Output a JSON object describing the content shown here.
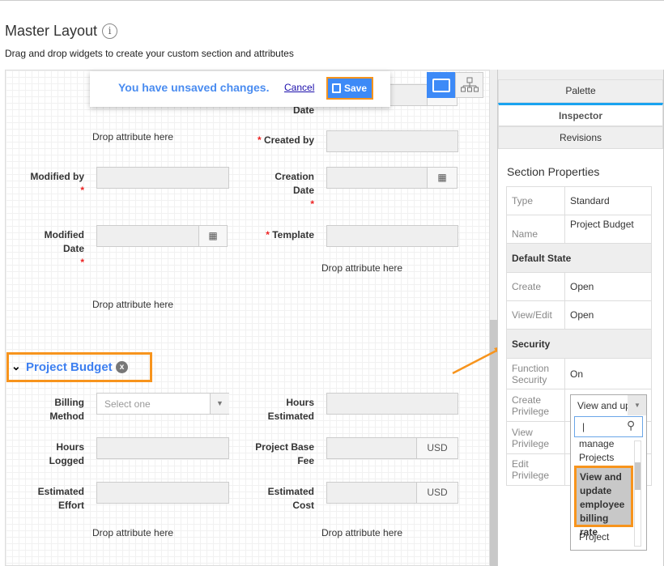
{
  "header": {
    "title": "Master Layout",
    "info_icon": "i",
    "subtitle": "Drag and drop widgets to create your custom section and attributes"
  },
  "toast": {
    "message": "You have unsaved changes.",
    "cancel": "Cancel",
    "save": "Save"
  },
  "form": {
    "date_label": "Date",
    "drop": "Drop attribute here",
    "created_by": "Created by",
    "modified_by": "Modified by",
    "creation_date": [
      "Creation",
      "Date"
    ],
    "modified_date": [
      "Modified",
      "Date"
    ],
    "template": "Template",
    "required_mark": "*",
    "section_title": "Project Budget",
    "billing_method": [
      "Billing",
      "Method"
    ],
    "billing_placeholder": "Select one",
    "hours_estimated": [
      "Hours",
      "Estimated"
    ],
    "hours_logged": [
      "Hours",
      "Logged"
    ],
    "project_base_fee": [
      "Project Base",
      "Fee"
    ],
    "estimated_effort": [
      "Estimated",
      "Effort"
    ],
    "estimated_cost": [
      "Estimated",
      "Cost"
    ],
    "currency": "USD"
  },
  "panel": {
    "tabs": [
      "Palette",
      "Inspector",
      "Revisions"
    ],
    "active_tab": "Inspector",
    "heading": "Section Properties",
    "type_label": "Type",
    "type_value": "Standard",
    "name_label": "Name",
    "name_value": "Project Budget",
    "default_state": "Default State",
    "create_label": "Create",
    "create_value": "Open",
    "viewedit_label": "View/Edit",
    "viewedit_value": "Open",
    "security": "Security",
    "function_security": "Function Security",
    "function_security_value": "On",
    "create_privilege": "Create Privilege",
    "create_privilege_value": "View and up",
    "view_privilege": "View Privilege",
    "edit_privilege": "Edit Privilege",
    "dropdown": {
      "search_value": "|",
      "options": [
        "manage Projects",
        "View and update employee billing rate",
        "Project"
      ],
      "highlighted": "View and update employee billing rate"
    }
  },
  "colors": {
    "accent": "#3d8af7",
    "highlight": "#f7941d",
    "tab_indicator": "#1aa3f0"
  }
}
